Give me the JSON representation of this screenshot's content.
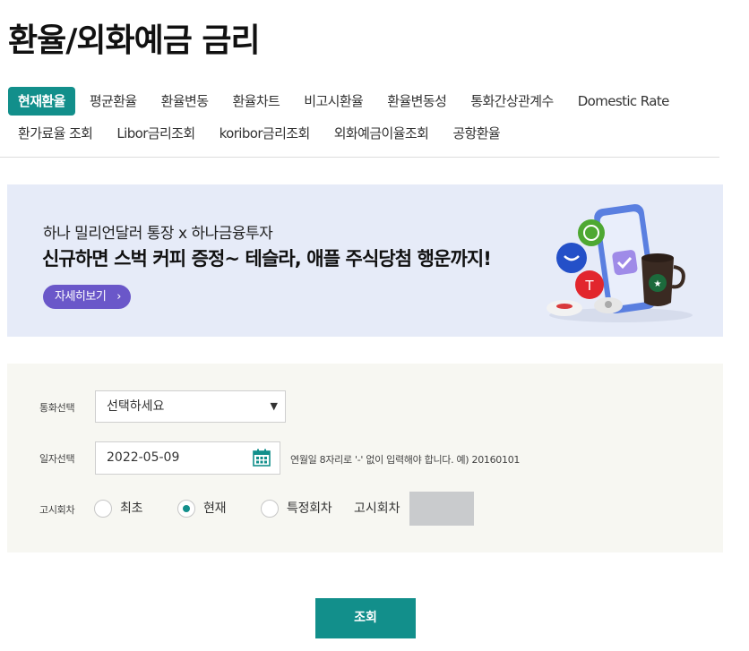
{
  "page": {
    "title": "환율/외화예금 금리"
  },
  "tabs": {
    "row1": [
      {
        "label": "현재환율",
        "active": true
      },
      {
        "label": "평균환율"
      },
      {
        "label": "환율변동"
      },
      {
        "label": "환율차트"
      },
      {
        "label": "비고시환율"
      },
      {
        "label": "환율변동성"
      },
      {
        "label": "통화간상관계수"
      },
      {
        "label": "Domestic Rate"
      }
    ],
    "row2": [
      {
        "label": "환가료율 조회"
      },
      {
        "label": "Libor금리조회"
      },
      {
        "label": "koribor금리조회"
      },
      {
        "label": "외화예금이율조회"
      },
      {
        "label": "공항환율"
      }
    ]
  },
  "banner": {
    "subtitle": "하나 밀리언달러 통장 x 하나금융투자",
    "headline": "신규하면 스벅 커피 증정~ 테슬라, 애플 주식당첨 행운까지!",
    "button_label": "자세히보기",
    "chevron": "›"
  },
  "form": {
    "currency_label": "통화선택",
    "currency_value": "선택하세요",
    "date_label": "일자선택",
    "date_value": "2022-05-09",
    "date_hint": "연월일 8자리로 '-' 없이 입력해야 합니다. 예) 20160101",
    "round_label": "고시회차",
    "options": [
      {
        "label": "최초",
        "checked": false
      },
      {
        "label": "현재",
        "checked": true
      },
      {
        "label": "특정회차",
        "checked": false
      }
    ],
    "round_input_label": "고시회차"
  },
  "actions": {
    "search_label": "조회"
  },
  "colors": {
    "accent": "#128f8b",
    "banner_bg": "#e6ebf8",
    "banner_button": "#6a57c9",
    "form_bg": "#f7f7f2"
  }
}
